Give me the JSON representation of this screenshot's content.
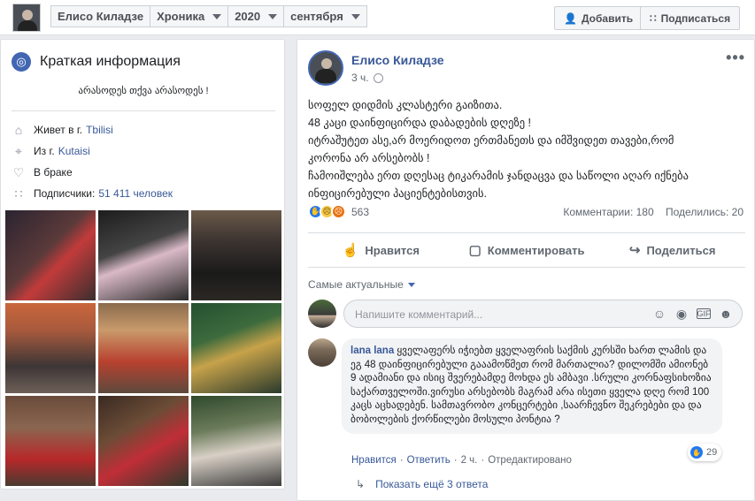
{
  "topbar": {
    "breadcrumbs": [
      "Елисо Киладзе",
      "Хроника",
      "2020",
      "сентября"
    ],
    "add_label": "Добавить",
    "subscribe_label": "Подписаться"
  },
  "intro": {
    "title": "Краткая информация",
    "bio": "არასოდეს თქვა არასოდეს !",
    "rows": {
      "lives_prefix": "Живет в г.",
      "lives_city": "Tbilisi",
      "from_prefix": "Из г.",
      "from_city": "Kutaisi",
      "relationship": "В браке",
      "followers_prefix": "Подписчики:",
      "followers_count": "51 411 человек"
    }
  },
  "post": {
    "author": "Елисо Киладзе",
    "time": "3 ч.",
    "lines": [
      "სოფელ დიდმის კლასტერი გაიზითა.",
      "48 კაცი დაინფიცირდა დაბადების დღეზე !",
      "იტრაშუტეთ ასე,არ მოერიდოთ ერთმანეთს და იმშვიდეთ თავები,რომ",
      "კორონა არ არსებობს !",
      "ჩამოიშლება ერთ დღესაც ტიკარამის ჯანდაცვა და საწოლი აღარ იქნება",
      "ინფიცირებული პაციენტებისთვის."
    ],
    "reactions_count": "563",
    "comments_stat": "Комментарии: 180",
    "shares_stat": "Поделились: 20",
    "actions": {
      "like": "Нравится",
      "comment": "Комментировать",
      "share": "Поделиться"
    },
    "sort_label": "Самые актуальные",
    "comment_placeholder": "Напишите комментарий...",
    "comment": {
      "author": "lana lana",
      "text": "ყველაფერს იჭიებთ ყველაფრის საქმის კურსში ხართ ლამის და ეგ 48 დაინფიცირებული გააამოწმეთ რომ მართალია? დილომში ამიონებ 9 ადამიანი და ისიც შვერებამდე მოხდა ეს ამბავი .სრული კორნაფსიხოზია საქართველოში.ვირუსი არსებობს მაგრამ არა ისეთი ყველა დღე რომ 100 კაცს აცხადებენ. სამთავრობო კონცერტები ,საარჩევნო შეკრებები და და ბობოლების ქორწილები მოსული პონტია ?",
      "like_link": "Нравится",
      "reply_link": "Ответить",
      "time": "2 ч.",
      "edited": "Отредактировано",
      "reaction_count": "29"
    },
    "show_more": "Показать ещё 3 ответа"
  },
  "colors": {
    "brand": "#4267b2",
    "link": "#385898",
    "background": "#e9ebee"
  }
}
